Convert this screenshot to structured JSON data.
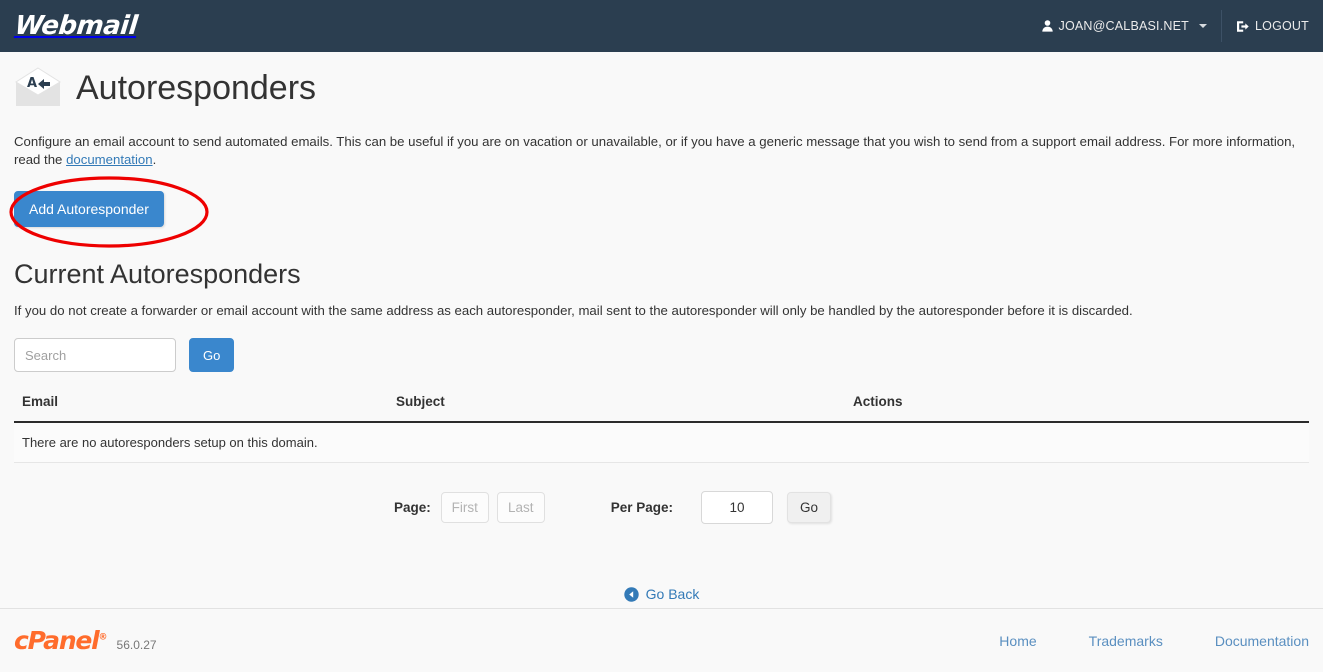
{
  "navbar": {
    "brand": "Webmail",
    "user_menu": {
      "label": "JOAN@CALBASI.NET",
      "icon": "user-icon"
    },
    "logout": {
      "label": "LOGOUT",
      "icon": "sign-out-icon"
    }
  },
  "page": {
    "title": "Autoresponders",
    "icon": "autoresponder-envelope-icon",
    "lead_part1": "Configure an email account to send automated emails. This can be useful if you are on vacation or unavailable, or if you have a generic message that you wish to send from a support email address. For more information, read the ",
    "lead_link": "documentation",
    "lead_part2": ".",
    "add_button": "Add Autoresponder",
    "section_title": "Current Autoresponders",
    "section_note": "If you do not create a forwarder or email account with the same address as each autoresponder, mail sent to the autoresponder will only be handled by the autoresponder before it is discarded."
  },
  "search": {
    "placeholder": "Search",
    "value": "",
    "go_label": "Go"
  },
  "table": {
    "headers": [
      "Email",
      "Subject",
      "Actions"
    ],
    "empty_message": "There are no autoresponders setup on this domain.",
    "rows": []
  },
  "pagination": {
    "page_label": "Page:",
    "first_label": "First",
    "last_label": "Last",
    "per_page_label": "Per Page:",
    "per_page_value": "10",
    "go_label": "Go"
  },
  "go_back": {
    "label": "Go Back",
    "icon": "arrow-circle-left-icon"
  },
  "footer": {
    "logo": "cPanel",
    "registered_mark": "®",
    "version": "56.0.27",
    "links": [
      "Home",
      "Trademarks",
      "Documentation"
    ]
  },
  "annotation": {
    "shape": "ellipse",
    "color": "#ee0000",
    "target": "add-autoresponder-button"
  },
  "colors": {
    "navbar_bg": "#2b3e50",
    "primary_blue": "#3a87cd",
    "link_blue": "#337ab7",
    "page_bg": "#f9f9f9",
    "cpanel_orange": "#ff6c2c",
    "annotation_red": "#ee0000"
  }
}
